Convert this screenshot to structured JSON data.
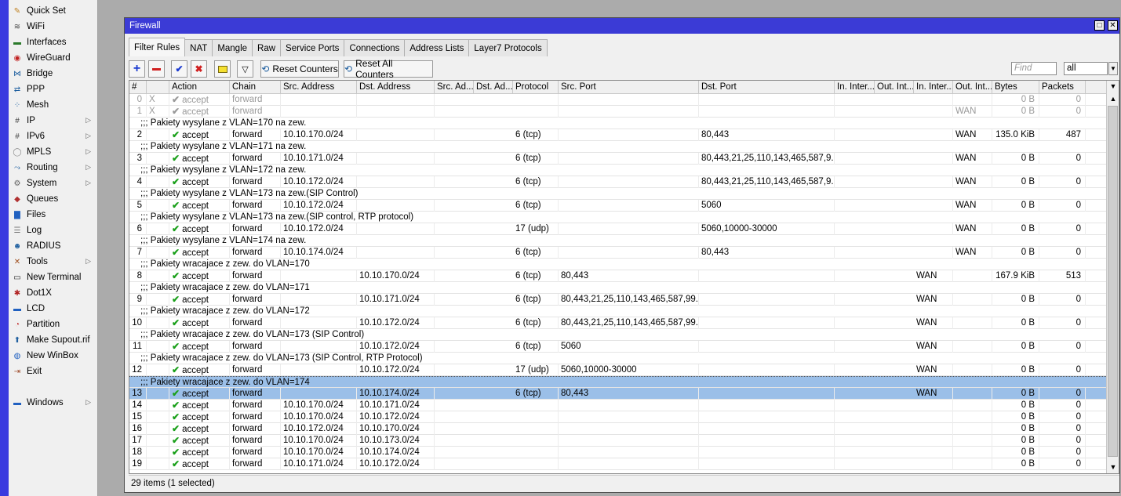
{
  "menu": [
    {
      "label": "Quick Set",
      "icon": "quick-set-icon",
      "color": "#c08020",
      "glyph": "✎",
      "arrow": false
    },
    {
      "label": "WiFi",
      "icon": "wifi-icon",
      "color": "#444",
      "glyph": "≋",
      "arrow": false
    },
    {
      "label": "Interfaces",
      "icon": "interfaces-icon",
      "color": "#2a7a2a",
      "glyph": "▬",
      "arrow": false
    },
    {
      "label": "WireGuard",
      "icon": "wireguard-icon",
      "color": "#c02020",
      "glyph": "◉",
      "arrow": false
    },
    {
      "label": "Bridge",
      "icon": "bridge-icon",
      "color": "#2060a0",
      "glyph": "⋈",
      "arrow": false
    },
    {
      "label": "PPP",
      "icon": "ppp-icon",
      "color": "#2060a0",
      "glyph": "⇄",
      "arrow": false
    },
    {
      "label": "Mesh",
      "icon": "mesh-icon",
      "color": "#2060a0",
      "glyph": "⁘",
      "arrow": false
    },
    {
      "label": "IP",
      "icon": "ip-icon",
      "color": "#444",
      "glyph": "#",
      "arrow": true
    },
    {
      "label": "IPv6",
      "icon": "ipv6-icon",
      "color": "#444",
      "glyph": "#",
      "arrow": true
    },
    {
      "label": "MPLS",
      "icon": "mpls-icon",
      "color": "#888",
      "glyph": "◯",
      "arrow": true
    },
    {
      "label": "Routing",
      "icon": "routing-icon",
      "color": "#2060a0",
      "glyph": "⤳",
      "arrow": true
    },
    {
      "label": "System",
      "icon": "system-icon",
      "color": "#666",
      "glyph": "⚙",
      "arrow": true
    },
    {
      "label": "Queues",
      "icon": "queues-icon",
      "color": "#b03030",
      "glyph": "◆",
      "arrow": false
    },
    {
      "label": "Files",
      "icon": "files-icon",
      "color": "#2060c0",
      "glyph": "▇",
      "arrow": false
    },
    {
      "label": "Log",
      "icon": "log-icon",
      "color": "#777",
      "glyph": "☰",
      "arrow": false
    },
    {
      "label": "RADIUS",
      "icon": "radius-icon",
      "color": "#2060a0",
      "glyph": "☻",
      "arrow": false
    },
    {
      "label": "Tools",
      "icon": "tools-icon",
      "color": "#a05020",
      "glyph": "✕",
      "arrow": true
    },
    {
      "label": "New Terminal",
      "icon": "terminal-icon",
      "color": "#222",
      "glyph": "▭",
      "arrow": false
    },
    {
      "label": "Dot1X",
      "icon": "dot1x-icon",
      "color": "#b02020",
      "glyph": "✱",
      "arrow": false
    },
    {
      "label": "LCD",
      "icon": "lcd-icon",
      "color": "#2060c0",
      "glyph": "▬",
      "arrow": false
    },
    {
      "label": "Partition",
      "icon": "partition-icon",
      "color": "#c03030",
      "glyph": "◔",
      "arrow": false
    },
    {
      "label": "Make Supout.rif",
      "icon": "supout-icon",
      "color": "#2060a0",
      "glyph": "⬆",
      "arrow": false
    },
    {
      "label": "New WinBox",
      "icon": "winbox-icon",
      "color": "#2060c0",
      "glyph": "◍",
      "arrow": false
    },
    {
      "label": "Exit",
      "icon": "exit-icon",
      "color": "#a05030",
      "glyph": "⇥",
      "arrow": false
    }
  ],
  "windows_menu": {
    "label": "Windows"
  },
  "window": {
    "title": "Firewall"
  },
  "tabs": [
    "Filter Rules",
    "NAT",
    "Mangle",
    "Raw",
    "Service Ports",
    "Connections",
    "Address Lists",
    "Layer7 Protocols"
  ],
  "toolbar": {
    "reset_counters": "Reset Counters",
    "reset_all_counters": "Reset All Counters",
    "find_placeholder": "Find",
    "filter_value": "all"
  },
  "columns": [
    "#",
    "",
    "Action",
    "Chain",
    "Src. Address",
    "Dst. Address",
    "Src. Ad...",
    "Dst. Ad...",
    "Protocol",
    "Src. Port",
    "Dst. Port",
    "In. Inter...",
    "Out. Int...",
    "In. Inter...",
    "Out. Int...",
    "Bytes",
    "Packets"
  ],
  "rows": [
    {
      "type": "rule",
      "disabled": true,
      "num": "0",
      "flag": "X",
      "action": "accept",
      "chain": "forward",
      "src": "",
      "dst": "",
      "proto": "",
      "sport": "",
      "dport": "",
      "in_list": "",
      "out_list": "",
      "bytes": "0 B",
      "packets": "0"
    },
    {
      "type": "rule",
      "disabled": true,
      "num": "1",
      "flag": "X",
      "action": "accept",
      "chain": "forward",
      "src": "",
      "dst": "",
      "proto": "",
      "sport": "",
      "dport": "",
      "in_list": "",
      "out_list": "WAN",
      "bytes": "0 B",
      "packets": "0"
    },
    {
      "type": "comment",
      "text": ";;; Pakiety wysylane z VLAN=170 na zew."
    },
    {
      "type": "rule",
      "num": "2",
      "action": "accept",
      "chain": "forward",
      "src": "10.10.170.0/24",
      "dst": "",
      "proto": "6 (tcp)",
      "sport": "",
      "dport": "80,443",
      "in_list": "",
      "out_list": "WAN",
      "bytes": "135.0 KiB",
      "packets": "487"
    },
    {
      "type": "comment",
      "text": ";;; Pakiety wysylane z VLAN=171 na zew."
    },
    {
      "type": "rule",
      "num": "3",
      "action": "accept",
      "chain": "forward",
      "src": "10.10.171.0/24",
      "dst": "",
      "proto": "6 (tcp)",
      "sport": "",
      "dport": "80,443,21,25,110,143,465,587,9...",
      "in_list": "",
      "out_list": "WAN",
      "bytes": "0 B",
      "packets": "0"
    },
    {
      "type": "comment",
      "text": ";;; Pakiety wysylane z VLAN=172 na zew."
    },
    {
      "type": "rule",
      "num": "4",
      "action": "accept",
      "chain": "forward",
      "src": "10.10.172.0/24",
      "dst": "",
      "proto": "6 (tcp)",
      "sport": "",
      "dport": "80,443,21,25,110,143,465,587,9...",
      "in_list": "",
      "out_list": "WAN",
      "bytes": "0 B",
      "packets": "0"
    },
    {
      "type": "comment",
      "text": ";;; Pakiety wysylane z VLAN=173 na zew.(SIP Control)"
    },
    {
      "type": "rule",
      "num": "5",
      "action": "accept",
      "chain": "forward",
      "src": "10.10.172.0/24",
      "dst": "",
      "proto": "6 (tcp)",
      "sport": "",
      "dport": "5060",
      "in_list": "",
      "out_list": "WAN",
      "bytes": "0 B",
      "packets": "0"
    },
    {
      "type": "comment",
      "text": ";;; Pakiety wysylane z VLAN=173 na zew.(SIP control, RTP protocol)"
    },
    {
      "type": "rule",
      "num": "6",
      "action": "accept",
      "chain": "forward",
      "src": "10.10.172.0/24",
      "dst": "",
      "proto": "17 (udp)",
      "sport": "",
      "dport": "5060,10000-30000",
      "in_list": "",
      "out_list": "WAN",
      "bytes": "0 B",
      "packets": "0"
    },
    {
      "type": "comment",
      "text": ";;; Pakiety wysylane z VLAN=174 na zew."
    },
    {
      "type": "rule",
      "num": "7",
      "action": "accept",
      "chain": "forward",
      "src": "10.10.174.0/24",
      "dst": "",
      "proto": "6 (tcp)",
      "sport": "",
      "dport": "80,443",
      "in_list": "",
      "out_list": "WAN",
      "bytes": "0 B",
      "packets": "0"
    },
    {
      "type": "comment",
      "text": ";;; Pakiety wracajace z zew. do VLAN=170"
    },
    {
      "type": "rule",
      "num": "8",
      "action": "accept",
      "chain": "forward",
      "src": "",
      "dst": "10.10.170.0/24",
      "proto": "6 (tcp)",
      "sport": "80,443",
      "dport": "",
      "in_list": "WAN",
      "out_list": "",
      "bytes": "167.9 KiB",
      "packets": "513"
    },
    {
      "type": "comment",
      "text": ";;; Pakiety wracajace z zew. do VLAN=171"
    },
    {
      "type": "rule",
      "num": "9",
      "action": "accept",
      "chain": "forward",
      "src": "",
      "dst": "10.10.171.0/24",
      "proto": "6 (tcp)",
      "sport": "80,443,21,25,110,143,465,587,99...",
      "dport": "",
      "in_list": "WAN",
      "out_list": "",
      "bytes": "0 B",
      "packets": "0"
    },
    {
      "type": "comment",
      "text": ";;; Pakiety wracajace z zew. do VLAN=172"
    },
    {
      "type": "rule",
      "num": "10",
      "action": "accept",
      "chain": "forward",
      "src": "",
      "dst": "10.10.172.0/24",
      "proto": "6 (tcp)",
      "sport": "80,443,21,25,110,143,465,587,99...",
      "dport": "",
      "in_list": "WAN",
      "out_list": "",
      "bytes": "0 B",
      "packets": "0"
    },
    {
      "type": "comment",
      "text": ";;; Pakiety wracajace z zew. do VLAN=173 (SIP Control)"
    },
    {
      "type": "rule",
      "num": "11",
      "action": "accept",
      "chain": "forward",
      "src": "",
      "dst": "10.10.172.0/24",
      "proto": "6 (tcp)",
      "sport": "5060",
      "dport": "",
      "in_list": "WAN",
      "out_list": "",
      "bytes": "0 B",
      "packets": "0"
    },
    {
      "type": "comment",
      "text": ";;; Pakiety wracajace z zew. do VLAN=173 (SIP Control, RTP Protocol)"
    },
    {
      "type": "rule",
      "num": "12",
      "action": "accept",
      "chain": "forward",
      "src": "",
      "dst": "10.10.172.0/24",
      "proto": "17 (udp)",
      "sport": "5060,10000-30000",
      "dport": "",
      "in_list": "WAN",
      "out_list": "",
      "bytes": "0 B",
      "packets": "0"
    },
    {
      "type": "comment",
      "selected": true,
      "text": ";;; Pakiety wracajace z zew. do VLAN=174"
    },
    {
      "type": "rule",
      "selected": true,
      "num": "13",
      "action": "accept",
      "chain": "forward",
      "src": "",
      "dst": "10.10.174.0/24",
      "proto": "6 (tcp)",
      "sport": "80,443",
      "dport": "",
      "in_list": "WAN",
      "out_list": "",
      "bytes": "0 B",
      "packets": "0"
    },
    {
      "type": "rule",
      "num": "14",
      "action": "accept",
      "chain": "forward",
      "src": "10.10.170.0/24",
      "dst": "10.10.171.0/24",
      "proto": "",
      "sport": "",
      "dport": "",
      "in_list": "",
      "out_list": "",
      "bytes": "0 B",
      "packets": "0"
    },
    {
      "type": "rule",
      "num": "15",
      "action": "accept",
      "chain": "forward",
      "src": "10.10.170.0/24",
      "dst": "10.10.172.0/24",
      "proto": "",
      "sport": "",
      "dport": "",
      "in_list": "",
      "out_list": "",
      "bytes": "0 B",
      "packets": "0"
    },
    {
      "type": "rule",
      "num": "16",
      "action": "accept",
      "chain": "forward",
      "src": "10.10.172.0/24",
      "dst": "10.10.170.0/24",
      "proto": "",
      "sport": "",
      "dport": "",
      "in_list": "",
      "out_list": "",
      "bytes": "0 B",
      "packets": "0"
    },
    {
      "type": "rule",
      "num": "17",
      "action": "accept",
      "chain": "forward",
      "src": "10.10.170.0/24",
      "dst": "10.10.173.0/24",
      "proto": "",
      "sport": "",
      "dport": "",
      "in_list": "",
      "out_list": "",
      "bytes": "0 B",
      "packets": "0"
    },
    {
      "type": "rule",
      "num": "18",
      "action": "accept",
      "chain": "forward",
      "src": "10.10.170.0/24",
      "dst": "10.10.174.0/24",
      "proto": "",
      "sport": "",
      "dport": "",
      "in_list": "",
      "out_list": "",
      "bytes": "0 B",
      "packets": "0"
    },
    {
      "type": "rule",
      "num": "19",
      "action": "accept",
      "chain": "forward",
      "src": "10.10.171.0/24",
      "dst": "10.10.172.0/24",
      "proto": "",
      "sport": "",
      "dport": "",
      "in_list": "",
      "out_list": "",
      "bytes": "0 B",
      "packets": "0"
    }
  ],
  "status": "29 items (1 selected)",
  "colors": {
    "accent": "#3b3bd6",
    "selection": "#9bbfe8",
    "accept": "#1aa01a"
  }
}
